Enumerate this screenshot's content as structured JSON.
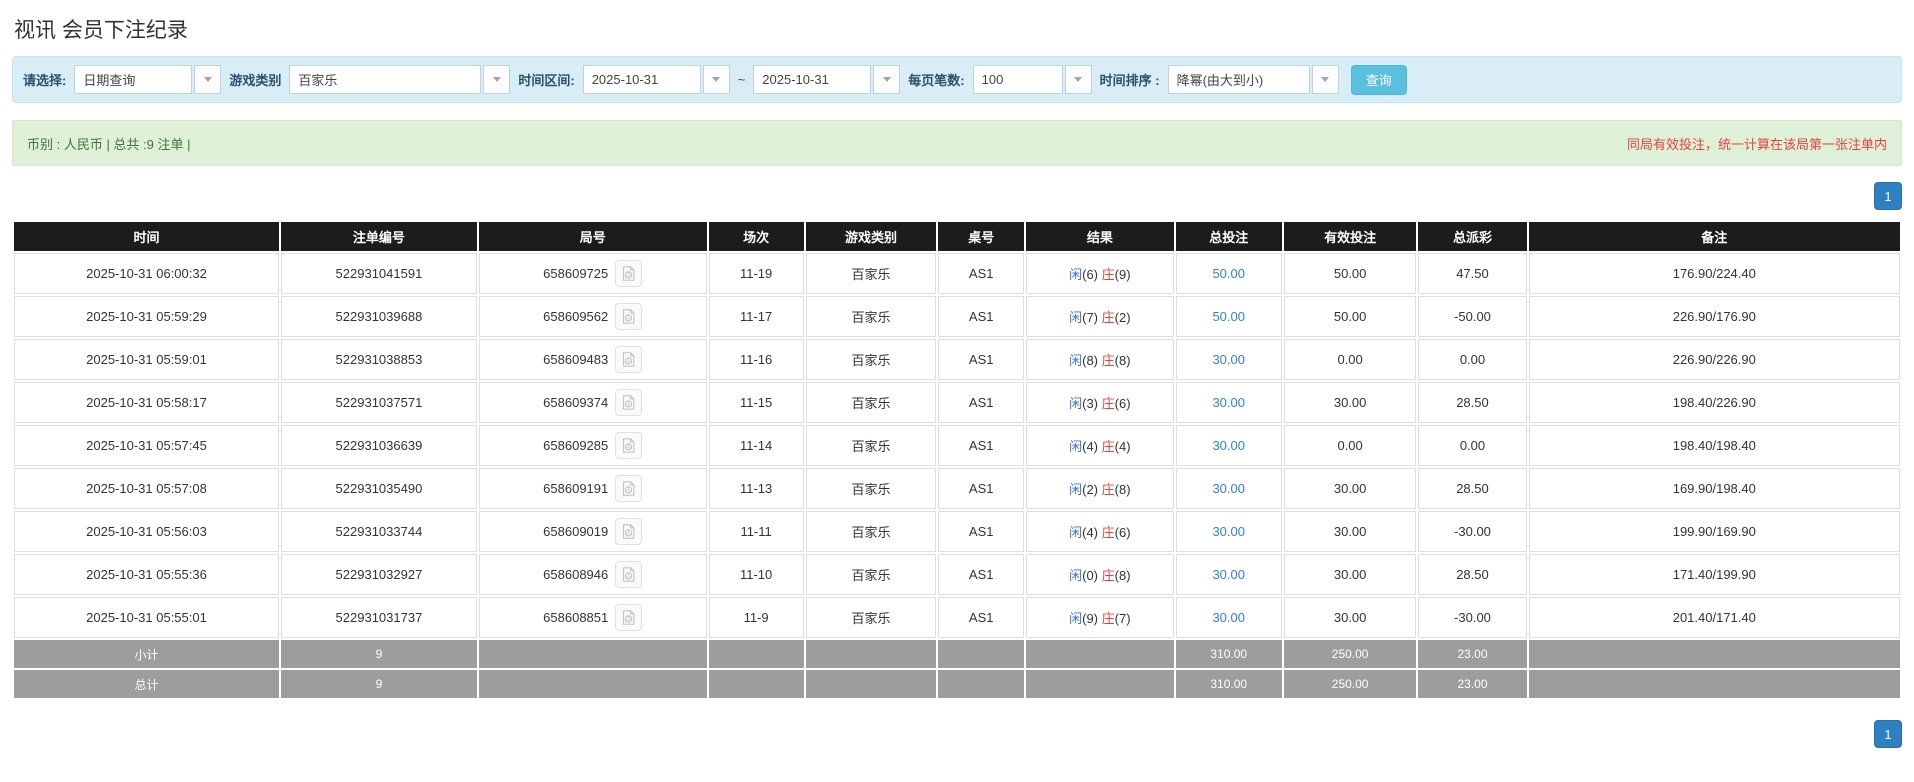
{
  "page": {
    "title": "视讯 会员下注纪录"
  },
  "colors": {
    "accent_blue": "#2f80e0",
    "negative_red": "#e5433a",
    "header_black": "#1c1c1c",
    "summary_gray": "#9d9d9d",
    "filter_bg": "#d9edf7",
    "info_bg": "#dff0d8",
    "button_blue": "#5bc0de",
    "pager_blue": "#2e80c2"
  },
  "filters": {
    "select_label": "请选择:",
    "select_value": "日期查询",
    "game_type_label": "游戏类别",
    "game_type_value": "百家乐",
    "date_range_label": "时间区间:",
    "date_from": "2025-10-31",
    "tilde": "~",
    "date_to": "2025-10-31",
    "page_size_label": "每页笔数:",
    "page_size_value": "100",
    "sort_label": "时间排序 :",
    "sort_value": "降幂(由大到小)",
    "search_button": "查询",
    "dropdown_icon": "caret-down"
  },
  "info_bar": {
    "left": "币别 : 人民币 | 总共 :9 注单 |",
    "right": "同局有效投注，统一计算在该局第一张注单内"
  },
  "pagination": {
    "page": "1"
  },
  "table": {
    "headers": [
      "时间",
      "注单编号",
      "局号",
      "场次",
      "游戏类别",
      "桌号",
      "结果",
      "总投注",
      "有效投注",
      "总派彩",
      "备注"
    ],
    "rows": [
      {
        "time": "2025-10-31 06:00:32",
        "bet_id": "522931041591",
        "round_id": "658609725",
        "session": "11-19",
        "game": "百家乐",
        "table_no": "AS1",
        "player_label": "闲",
        "player_score": "(6)",
        "banker_label": "庄",
        "banker_score": "(9)",
        "total_bet": "50.00",
        "valid_bet": "50.00",
        "payout": "47.50",
        "remark": "176.90/224.40"
      },
      {
        "time": "2025-10-31 05:59:29",
        "bet_id": "522931039688",
        "round_id": "658609562",
        "session": "11-17",
        "game": "百家乐",
        "table_no": "AS1",
        "player_label": "闲",
        "player_score": "(7)",
        "banker_label": "庄",
        "banker_score": "(2)",
        "total_bet": "50.00",
        "valid_bet": "50.00",
        "payout": "-50.00",
        "remark": "226.90/176.90"
      },
      {
        "time": "2025-10-31 05:59:01",
        "bet_id": "522931038853",
        "round_id": "658609483",
        "session": "11-16",
        "game": "百家乐",
        "table_no": "AS1",
        "player_label": "闲",
        "player_score": "(8)",
        "banker_label": "庄",
        "banker_score": "(8)",
        "total_bet": "30.00",
        "valid_bet": "0.00",
        "payout": "0.00",
        "remark": "226.90/226.90"
      },
      {
        "time": "2025-10-31 05:58:17",
        "bet_id": "522931037571",
        "round_id": "658609374",
        "session": "11-15",
        "game": "百家乐",
        "table_no": "AS1",
        "player_label": "闲",
        "player_score": "(3)",
        "banker_label": "庄",
        "banker_score": "(6)",
        "total_bet": "30.00",
        "valid_bet": "30.00",
        "payout": "28.50",
        "remark": "198.40/226.90"
      },
      {
        "time": "2025-10-31 05:57:45",
        "bet_id": "522931036639",
        "round_id": "658609285",
        "session": "11-14",
        "game": "百家乐",
        "table_no": "AS1",
        "player_label": "闲",
        "player_score": "(4)",
        "banker_label": "庄",
        "banker_score": "(4)",
        "total_bet": "30.00",
        "valid_bet": "0.00",
        "payout": "0.00",
        "remark": "198.40/198.40"
      },
      {
        "time": "2025-10-31 05:57:08",
        "bet_id": "522931035490",
        "round_id": "658609191",
        "session": "11-13",
        "game": "百家乐",
        "table_no": "AS1",
        "player_label": "闲",
        "player_score": "(2)",
        "banker_label": "庄",
        "banker_score": "(8)",
        "total_bet": "30.00",
        "valid_bet": "30.00",
        "payout": "28.50",
        "remark": "169.90/198.40"
      },
      {
        "time": "2025-10-31 05:56:03",
        "bet_id": "522931033744",
        "round_id": "658609019",
        "session": "11-11",
        "game": "百家乐",
        "table_no": "AS1",
        "player_label": "闲",
        "player_score": "(4)",
        "banker_label": "庄",
        "banker_score": "(6)",
        "total_bet": "30.00",
        "valid_bet": "30.00",
        "payout": "-30.00",
        "remark": "199.90/169.90"
      },
      {
        "time": "2025-10-31 05:55:36",
        "bet_id": "522931032927",
        "round_id": "658608946",
        "session": "11-10",
        "game": "百家乐",
        "table_no": "AS1",
        "player_label": "闲",
        "player_score": "(0)",
        "banker_label": "庄",
        "banker_score": "(8)",
        "total_bet": "30.00",
        "valid_bet": "30.00",
        "payout": "28.50",
        "remark": "171.40/199.90"
      },
      {
        "time": "2025-10-31 05:55:01",
        "bet_id": "522931031737",
        "round_id": "658608851",
        "session": "11-9",
        "game": "百家乐",
        "table_no": "AS1",
        "player_label": "闲",
        "player_score": "(9)",
        "banker_label": "庄",
        "banker_score": "(7)",
        "total_bet": "30.00",
        "valid_bet": "30.00",
        "payout": "-30.00",
        "remark": "201.40/171.40"
      }
    ],
    "subtotal": {
      "label": "小计",
      "count": "9",
      "total_bet": "310.00",
      "valid_bet": "250.00",
      "payout": "23.00"
    },
    "total": {
      "label": "总计",
      "count": "9",
      "total_bet": "310.00",
      "valid_bet": "250.00",
      "payout": "23.00"
    },
    "icons": {
      "video": "video-replay-icon"
    }
  }
}
